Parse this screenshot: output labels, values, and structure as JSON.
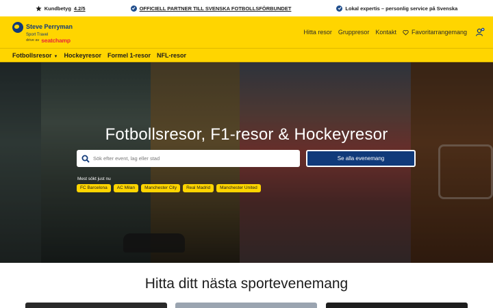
{
  "trustbar": {
    "rating_label": "Kundbetyg",
    "rating_value": "4.2/5",
    "partner_text": "OFFICIELL PARTNER TILL SVENSKA FOTBOLLSFÖRBUNDET",
    "service_text": "Lokal expertis – personlig service på Svenska"
  },
  "header": {
    "logo_name": "Steve Perryman",
    "logo_sub": "Sport Travel",
    "logo_drive": "drive av",
    "logo_brand": "seatchamp",
    "nav": [
      "Hitta resor",
      "Gruppresor",
      "Kontakt"
    ],
    "favorites_label": "Favoritarrangemang"
  },
  "categories": [
    "Fotbollsresor",
    "Hockeyresor",
    "Formel 1-resor",
    "NFL-resor"
  ],
  "hero": {
    "title": "Fotbollsresor, F1-resor & Hockeyresor",
    "search_placeholder": "Sök efter event, lag eller stad",
    "see_all_label": "Se alla evenemang",
    "most_searched_label": "Mest sökt just nu",
    "chips": [
      "FC Barcelona",
      "AC Milan",
      "Manchester City",
      "Real Madrid",
      "Manchester United"
    ]
  },
  "section": {
    "title": "Hitta ditt nästa sportevenemang"
  },
  "colors": {
    "brand_yellow": "#ffd500",
    "brand_blue": "#103a7a",
    "seatchamp_red": "#e8233b"
  },
  "icons": [
    "star-icon",
    "check-badge-icon",
    "heart-icon",
    "user-icon",
    "search-icon",
    "caret-down-icon"
  ]
}
